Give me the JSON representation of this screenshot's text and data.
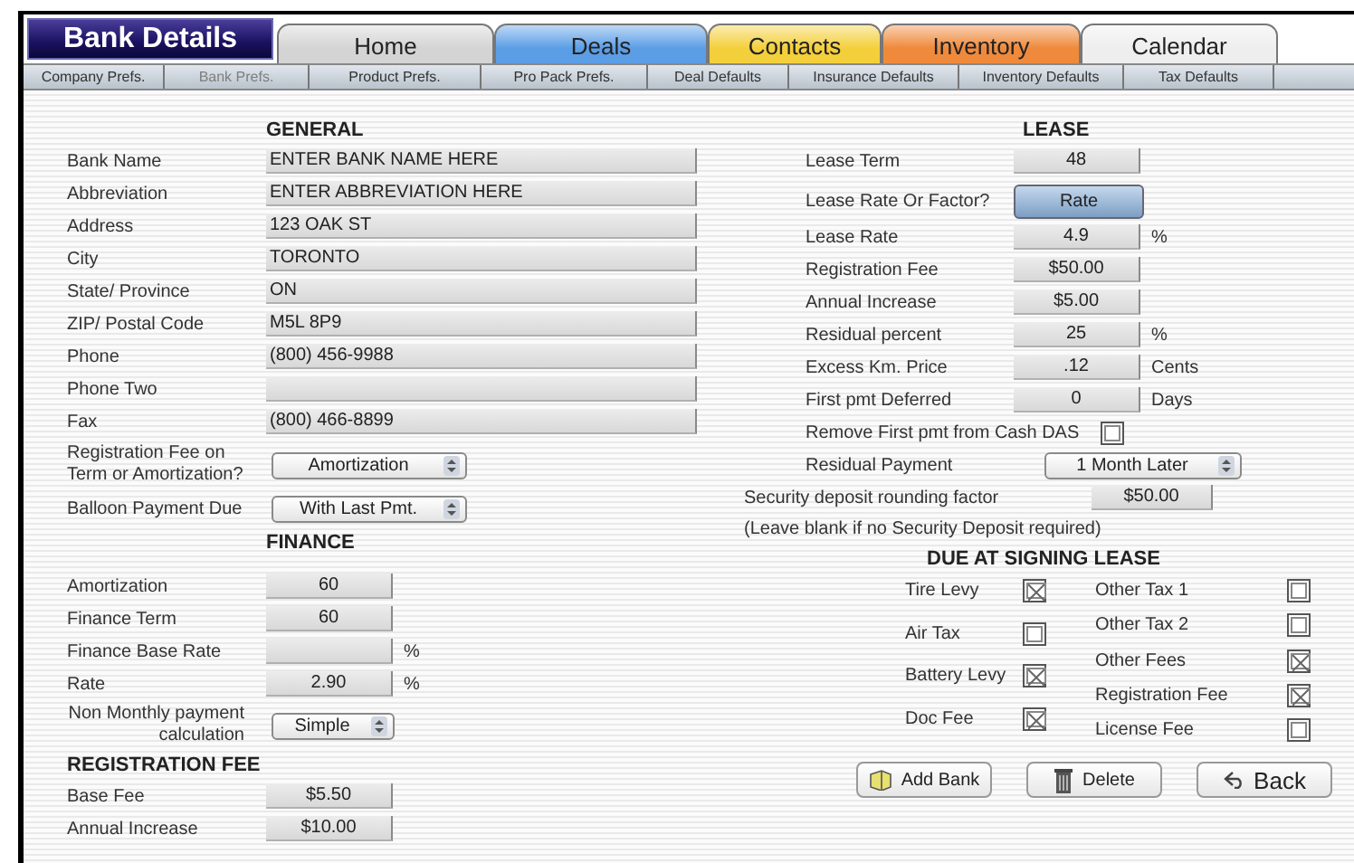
{
  "title": "Bank Details",
  "tabs": [
    {
      "label": "Home",
      "color": "#d4d4d4"
    },
    {
      "label": "Deals",
      "color": "#5c9ee6"
    },
    {
      "label": "Contacts",
      "color": "#f4cf3c"
    },
    {
      "label": "Inventory",
      "color": "#ef8a3c"
    },
    {
      "label": "Calendar",
      "color": "#eeeeee"
    }
  ],
  "subtabs": [
    {
      "label": "Company Prefs.",
      "selected": false
    },
    {
      "label": "Bank Prefs.",
      "selected": true
    },
    {
      "label": "Product Prefs.",
      "selected": false
    },
    {
      "label": "Pro Pack Prefs.",
      "selected": false
    },
    {
      "label": "Deal Defaults",
      "selected": false
    },
    {
      "label": "Insurance Defaults",
      "selected": false
    },
    {
      "label": "Inventory Defaults",
      "selected": false
    },
    {
      "label": "Tax Defaults",
      "selected": false
    }
  ],
  "general": {
    "heading": "GENERAL",
    "rows": [
      {
        "kind": "text",
        "label": "Bank Name",
        "value": "ENTER BANK NAME HERE"
      },
      {
        "kind": "text",
        "label": "Abbreviation",
        "value": "ENTER ABBREVIATION HERE"
      },
      {
        "kind": "text",
        "label": "Address",
        "value": "123 OAK ST"
      },
      {
        "kind": "text",
        "label": "City",
        "value": "TORONTO"
      },
      {
        "kind": "text",
        "label": "State/ Province",
        "value": "ON"
      },
      {
        "kind": "text",
        "label": "ZIP/ Postal Code",
        "value": "M5L 8P9"
      },
      {
        "kind": "text",
        "label": "Phone",
        "value": "(800) 456-9988"
      },
      {
        "kind": "text",
        "label": "Phone Two"
      },
      {
        "kind": "text",
        "label": "Fax",
        "value": "(800) 466-8899"
      },
      {
        "kind": "dropdown",
        "label": "Registration Fee on Term or Amortization?",
        "value": "Amortization"
      },
      {
        "kind": "dropdown",
        "label": "Balloon Payment Due",
        "value": "With Last Pmt."
      }
    ]
  },
  "finance": {
    "heading": "FINANCE",
    "rows": [
      {
        "kind": "number",
        "label": "Amortization",
        "value": "60"
      },
      {
        "kind": "number",
        "label": "Finance Term",
        "value": "60"
      },
      {
        "kind": "number",
        "label": "Finance Base Rate",
        "unit": "%"
      },
      {
        "kind": "number",
        "label": "Rate",
        "value": "2.90",
        "unit": "%"
      },
      {
        "kind": "small-dropdown",
        "label": "Non Monthly payment calculation",
        "value": "Simple"
      }
    ]
  },
  "registration_fee": {
    "heading": "REGISTRATION FEE",
    "rows": [
      {
        "kind": "number",
        "label": "Base Fee",
        "value": "$5.50"
      },
      {
        "kind": "number",
        "label": "Annual Increase",
        "value": "$10.00"
      }
    ]
  },
  "lease": {
    "heading": "LEASE",
    "rows": [
      {
        "kind": "number",
        "label": "Lease Term",
        "value": "48"
      },
      {
        "kind": "button",
        "label": "Lease Rate Or Factor?",
        "value": "Rate"
      },
      {
        "kind": "number",
        "label": "Lease Rate",
        "value": "4.9",
        "unit": "%"
      },
      {
        "kind": "number",
        "label": "Registration Fee",
        "value": "$50.00"
      },
      {
        "kind": "number",
        "label": "Annual Increase",
        "value": "$5.00"
      },
      {
        "kind": "number",
        "label": "Residual percent",
        "value": "25",
        "unit": "%"
      },
      {
        "kind": "number",
        "label": "Excess Km. Price",
        "value": ".12",
        "unit": "Cents"
      },
      {
        "kind": "number",
        "label": "First pmt Deferred",
        "value": "0",
        "unit": "Days"
      },
      {
        "kind": "checkbox",
        "label": "Remove First pmt from Cash DAS",
        "checked": false
      },
      {
        "kind": "dropdown",
        "label": "Residual Payment",
        "value": "1 Month Later"
      }
    ],
    "security_deposit": {
      "label": "Security deposit rounding factor",
      "value": "$50.00",
      "note": "(Leave blank if no Security Deposit required)"
    }
  },
  "due_at_signing": {
    "heading": "DUE AT SIGNING LEASE",
    "left": [
      {
        "label": "Tire Levy",
        "checked": true
      },
      {
        "label": "Air Tax",
        "checked": false
      },
      {
        "label": "Battery Levy",
        "checked": true
      },
      {
        "label": "Doc Fee",
        "checked": true
      }
    ],
    "right": [
      {
        "label": "Other Tax 1",
        "checked": false
      },
      {
        "label": "Other Tax 2",
        "checked": false
      },
      {
        "label": "Other Fees",
        "checked": true
      },
      {
        "label": "Registration Fee",
        "checked": true
      },
      {
        "label": "License Fee",
        "checked": false
      }
    ]
  },
  "buttons": [
    {
      "kind": "add",
      "label": "Add Bank"
    },
    {
      "kind": "delete",
      "label": "Delete"
    },
    {
      "kind": "back",
      "label": "Back"
    }
  ]
}
